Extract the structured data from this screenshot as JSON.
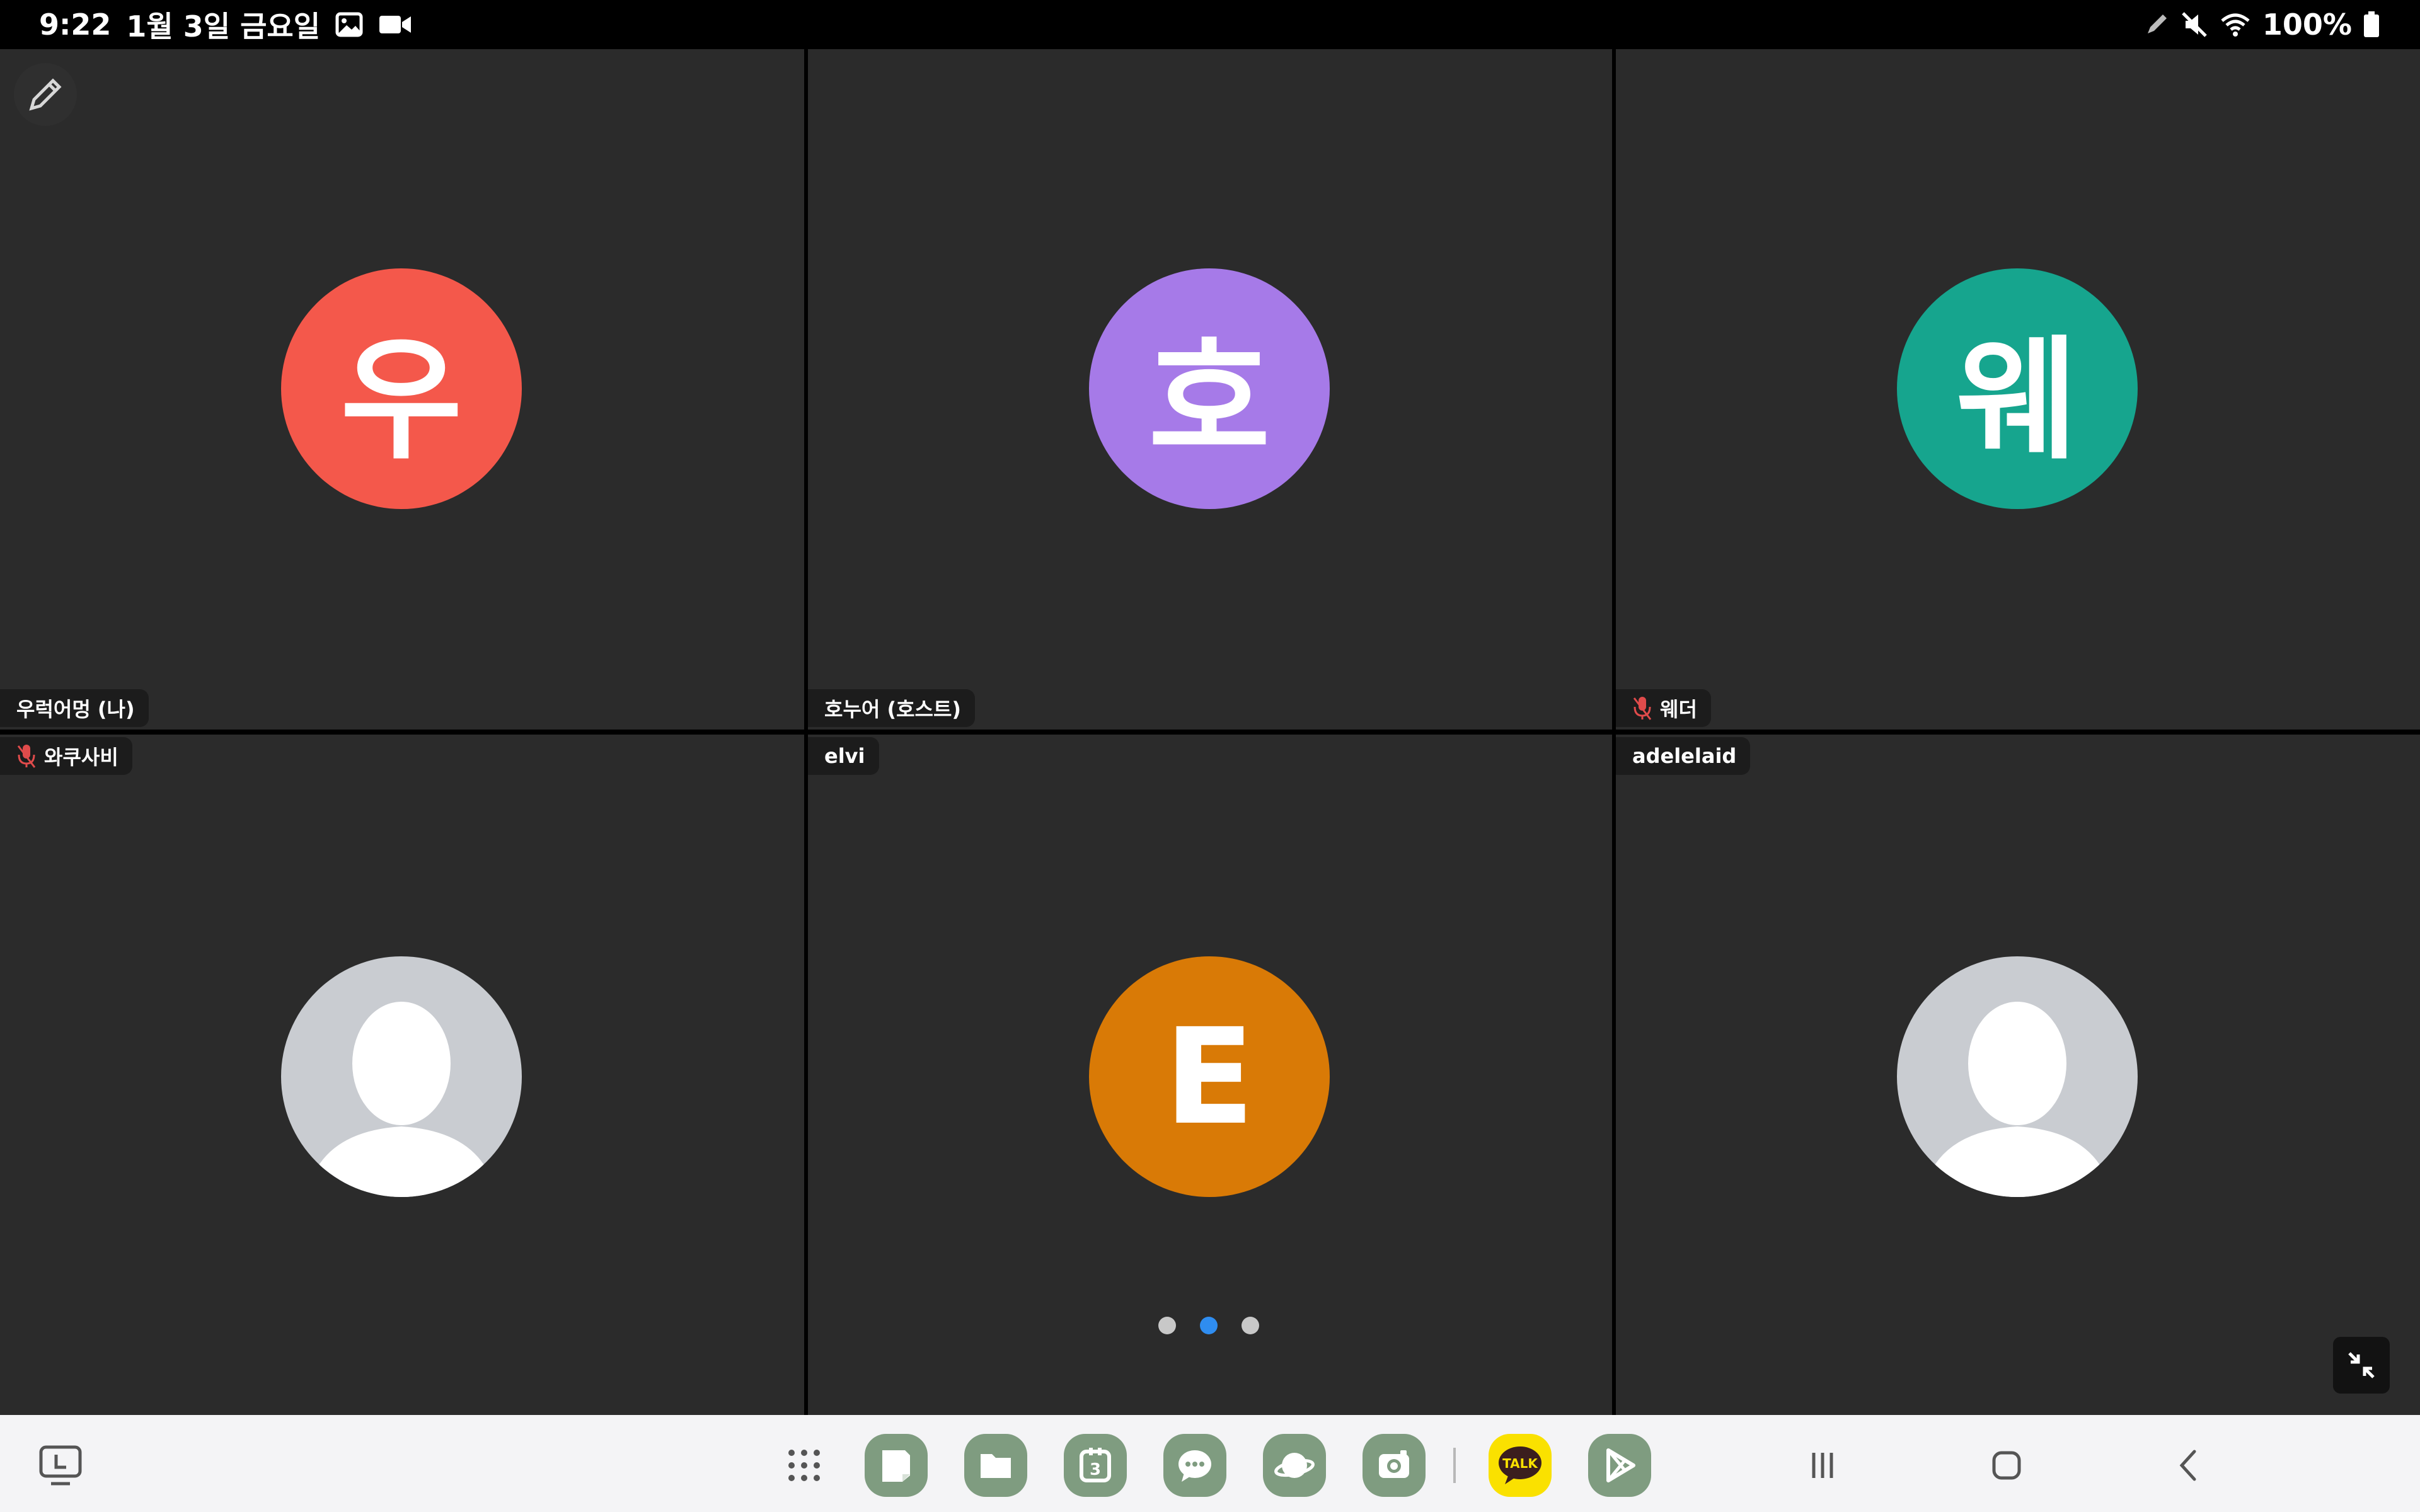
{
  "status_bar": {
    "time": "9:22",
    "date": "1월 3일 금요일",
    "battery": "100%",
    "icons": [
      "gallery-icon",
      "video-camera-icon",
      "pen-icon",
      "mute-icon",
      "wifi-icon",
      "battery-icon"
    ]
  },
  "meeting": {
    "pencil_icon": "pencil-icon",
    "participants": [
      {
        "initial": "우",
        "name": "우럭어멍 (나)",
        "color": "#f4584b",
        "muted": false
      },
      {
        "initial": "호",
        "name": "호누어 (호스트)",
        "color": "#a67ae8",
        "muted": false
      },
      {
        "initial": "웨",
        "name": "웨더",
        "color": "#16a58e",
        "muted": true
      },
      {
        "initial": "",
        "name": "와쿠사비",
        "color": "#c9ccd1",
        "muted": true
      },
      {
        "initial": "E",
        "name": "elvi",
        "color": "#d97a06",
        "muted": false
      },
      {
        "initial": "",
        "name": "adelelaid",
        "color": "#c9ccd1",
        "muted": false
      }
    ],
    "page_count": 3,
    "active_page": 2
  },
  "taskbar": {
    "left": [
      "screen-share-icon"
    ],
    "apps": [
      {
        "name": "apps-grid-icon",
        "color": "transparent"
      },
      {
        "name": "notes-icon",
        "color": "#7f9c80"
      },
      {
        "name": "files-icon",
        "color": "#7f9c80"
      },
      {
        "name": "calendar-icon",
        "color": "#7f9c80"
      },
      {
        "name": "messages-icon",
        "color": "#7f9c80"
      },
      {
        "name": "browser-icon",
        "color": "#7f9c80"
      },
      {
        "name": "camera-icon",
        "color": "#7f9c80"
      },
      {
        "name": "kakaotalk-icon",
        "color": "#fae100",
        "label": "TALK"
      },
      {
        "name": "play-store-icon",
        "color": "#7f9c80"
      }
    ],
    "nav": [
      "recent-apps-icon",
      "home-icon",
      "back-icon"
    ]
  }
}
